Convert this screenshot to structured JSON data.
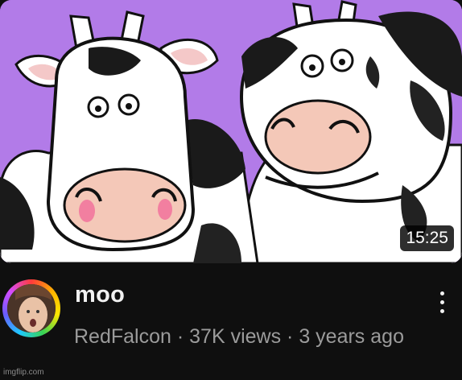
{
  "video": {
    "duration": "15:25",
    "title": "moo",
    "channel": "RedFalcon",
    "views": "37K views",
    "age": "3 years ago"
  },
  "watermark": "imgflip.com",
  "colors": {
    "background": "#0f0f0f",
    "title": "#f1f1f1",
    "meta": "#9b9b9b",
    "thumbnail_background": "#b27be8"
  },
  "icons": {
    "more": "vertical-ellipsis-icon"
  }
}
